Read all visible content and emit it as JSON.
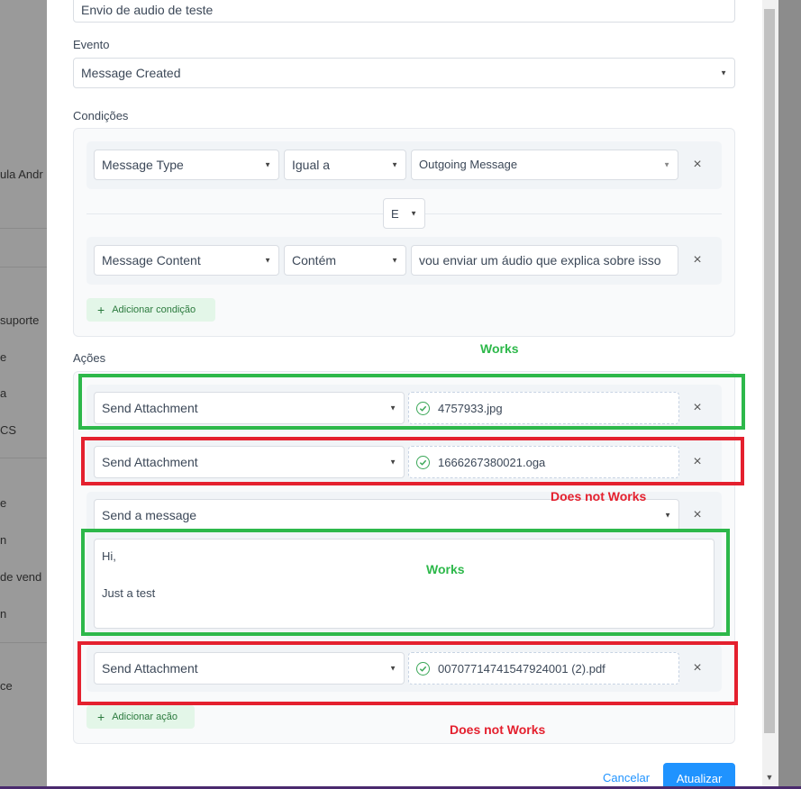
{
  "background": {
    "items": [
      "ula Andr",
      "suporte",
      "e",
      "a",
      "CS",
      "e",
      "n",
      "de vend",
      "n",
      "ce"
    ]
  },
  "form": {
    "name_value": "Envio de audio de teste",
    "event_label": "Evento",
    "event_value": "Message Created",
    "conditions_label": "Condições",
    "conditions": [
      {
        "attribute": "Message Type",
        "operator": "Igual a",
        "value": "Outgoing Message"
      },
      {
        "attribute": "Message Content",
        "operator": "Contém",
        "value": "vou enviar um áudio que explica sobre isso"
      }
    ],
    "join_operator": "E",
    "add_condition_label": "Adicionar condição",
    "actions_label": "Ações",
    "actions": [
      {
        "type": "Send Attachment",
        "file": "4757933.jpg"
      },
      {
        "type": "Send Attachment",
        "file": "1666267380021.oga"
      },
      {
        "type": "Send a message",
        "message_line1": "Hi,",
        "message_line2": "Just a test"
      },
      {
        "type": "Send Attachment",
        "file": "0070771474154792400‌1 (2).pdf"
      }
    ],
    "add_action_label": "Adicionar ação",
    "cancel_label": "Cancelar",
    "update_label": "Atualizar"
  },
  "annotations": {
    "works_1": "Works",
    "does_not_works_1": "Does not Works",
    "works_2": "Works",
    "does_not_works_2": "Does not Works",
    "green": "#2db84a",
    "red": "#e4202e"
  },
  "icons": {
    "close": "×",
    "caret": "▼",
    "plus": "+",
    "check": "check-circle-icon"
  }
}
